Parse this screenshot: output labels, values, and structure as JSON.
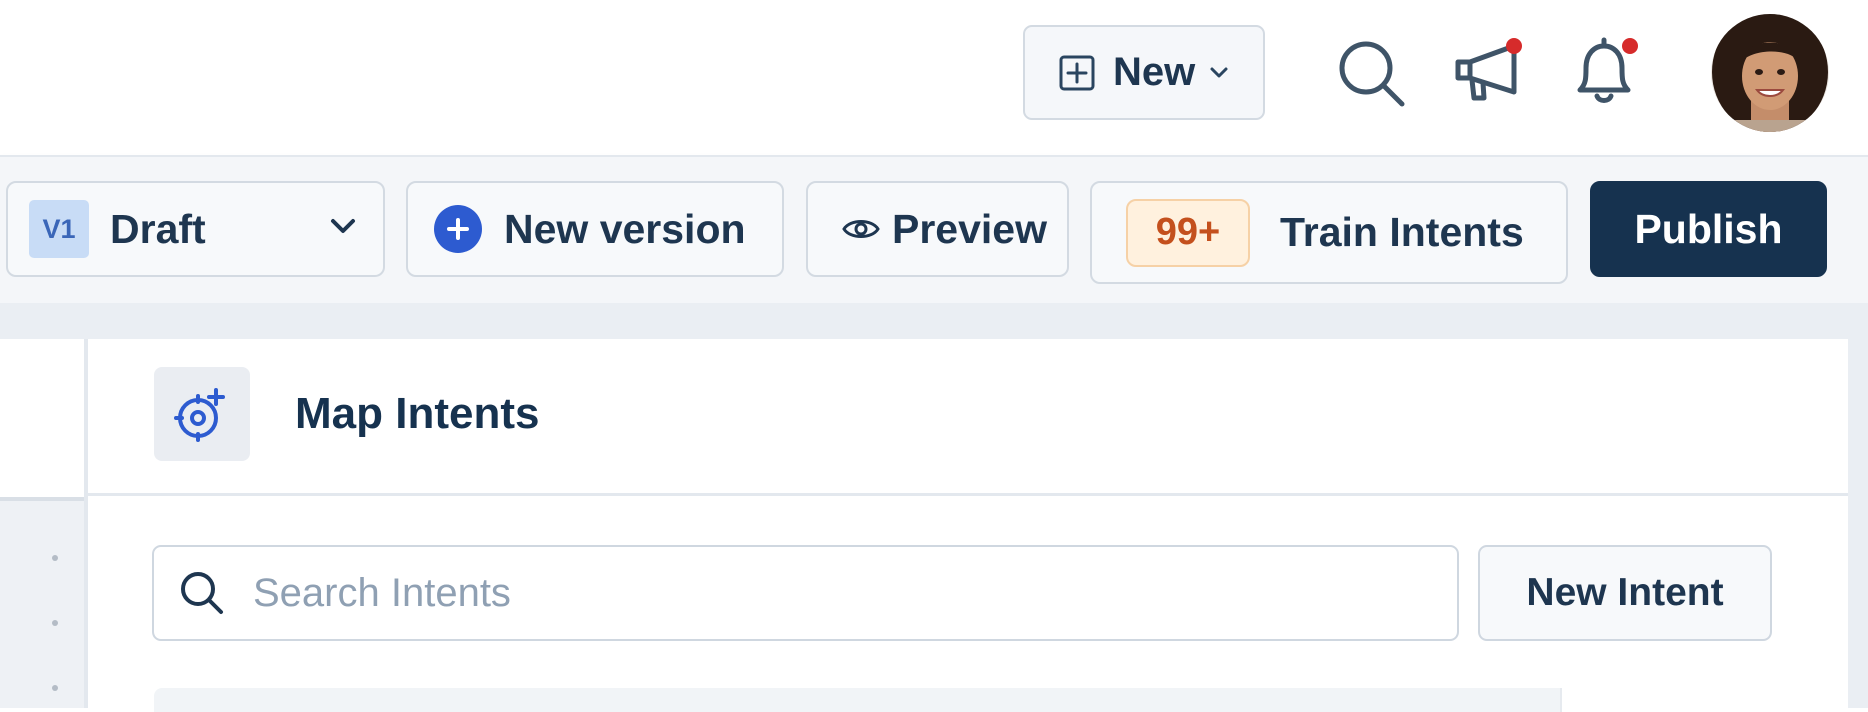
{
  "topbar": {
    "new_label": "New",
    "icons": [
      "plus-square-icon",
      "chevron-down-icon",
      "search-icon",
      "megaphone-icon",
      "bell-icon"
    ],
    "notification_dot_color": "#d62b2b"
  },
  "toolbar": {
    "version_tag": "V1",
    "version_status": "Draft",
    "new_version_label": "New version",
    "preview_label": "Preview",
    "train_badge": "99+",
    "train_label": "Train Intents",
    "publish_label": "Publish"
  },
  "colors": {
    "primary_dark": "#16324f",
    "accent_blue": "#2d5bd0",
    "badge_orange": "#c4501d"
  },
  "main": {
    "title": "Map Intents",
    "search_placeholder": "Search Intents",
    "new_intent_label": "New Intent"
  }
}
